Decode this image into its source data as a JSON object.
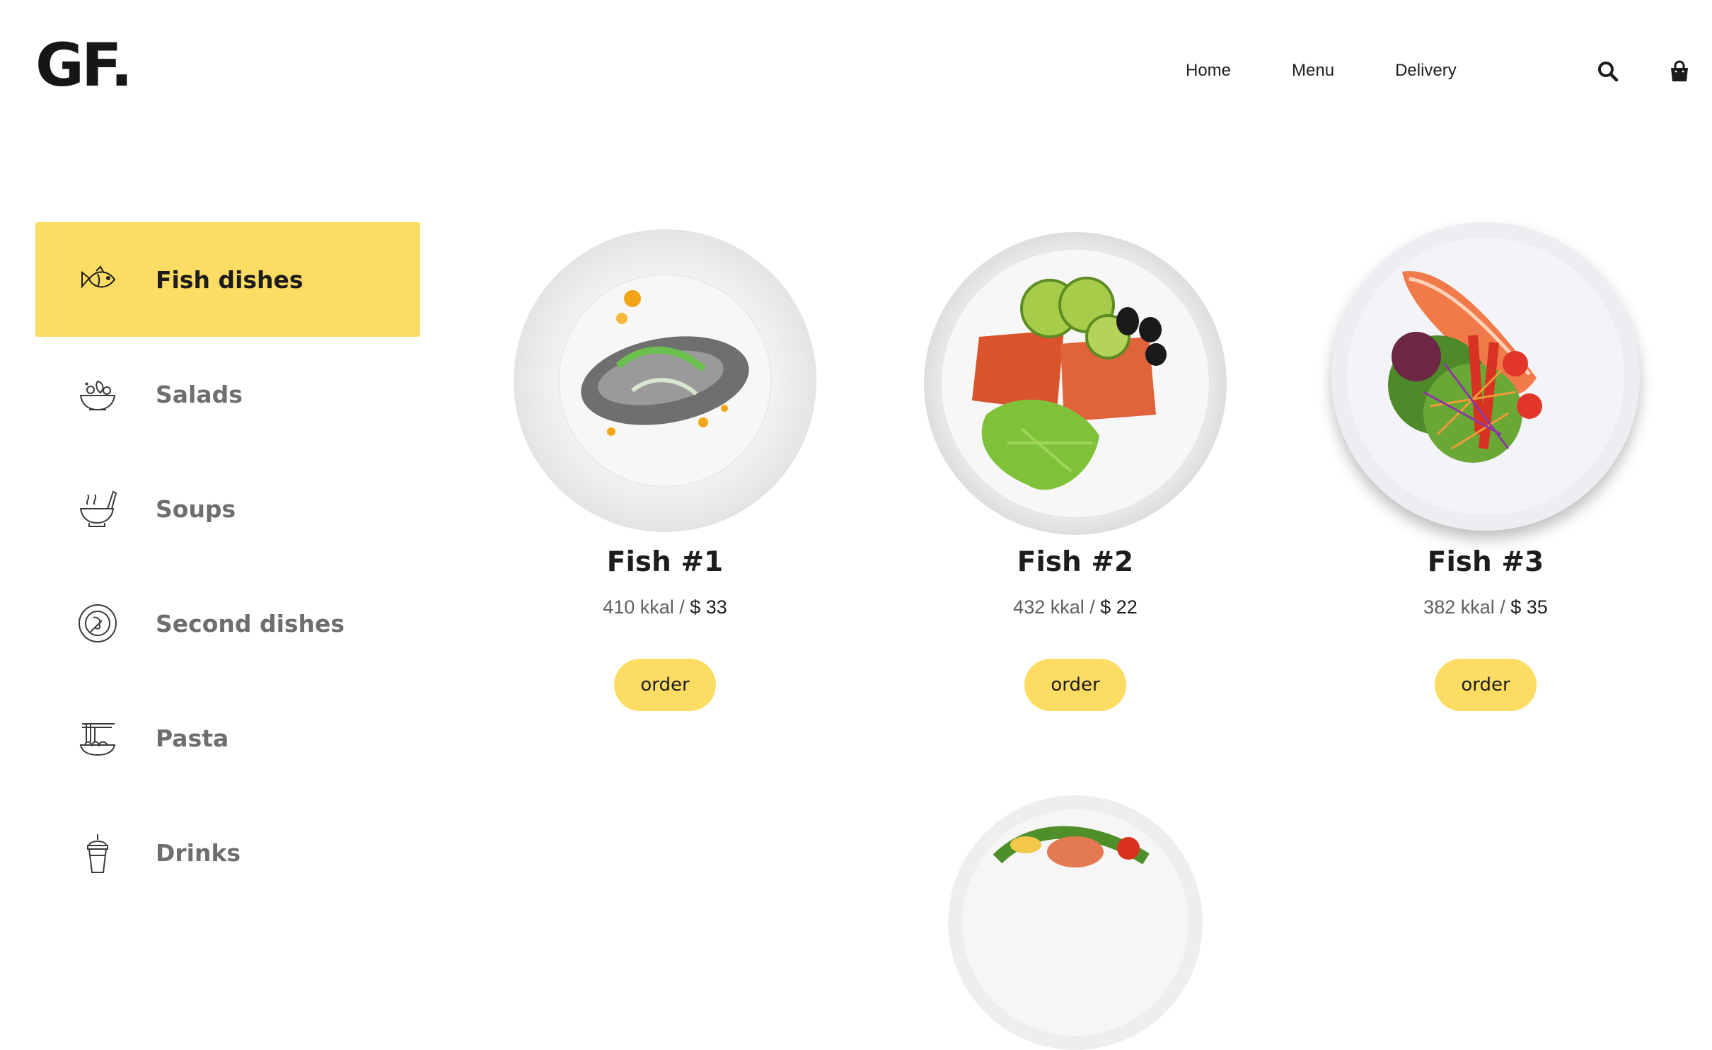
{
  "header": {
    "logo": "GF.",
    "nav": [
      "Home",
      "Menu",
      "Delivery"
    ],
    "icons": [
      "search-icon",
      "shopping-bag-icon"
    ]
  },
  "sidebar": {
    "items": [
      {
        "label": "Fish dishes",
        "icon": "fish-icon",
        "active": true
      },
      {
        "label": "Salads",
        "icon": "salad-bowl-icon",
        "active": false
      },
      {
        "label": "Soups",
        "icon": "soup-bowl-icon",
        "active": false
      },
      {
        "label": "Second dishes",
        "icon": "plate-dish-icon",
        "active": false
      },
      {
        "label": "Pasta",
        "icon": "pasta-icon",
        "active": false
      },
      {
        "label": "Drinks",
        "icon": "drink-cup-icon",
        "active": false
      }
    ]
  },
  "dishes": [
    {
      "name": "Fish #1",
      "kcal": "410 kkal",
      "sep": " / ",
      "price": "$ 33",
      "order": "order"
    },
    {
      "name": "Fish #2",
      "kcal": "432 kkal",
      "sep": " / ",
      "price": "$ 22",
      "order": "order"
    },
    {
      "name": "Fish #3",
      "kcal": "382 kkal",
      "sep": " / ",
      "price": "$ 35",
      "order": "order"
    }
  ],
  "colors": {
    "accent": "#fddc63",
    "text": "#1d1d1d",
    "muted": "#6e6e6e"
  }
}
